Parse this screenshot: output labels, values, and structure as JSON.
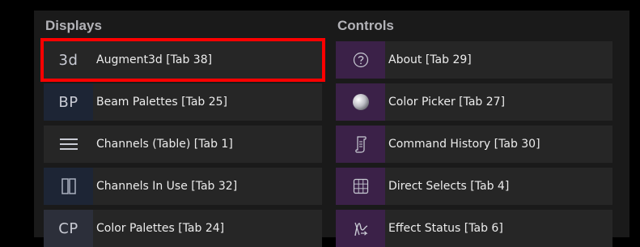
{
  "displays": {
    "title": "Displays",
    "items": [
      {
        "icon_text": "3d",
        "icon": "augment3d-icon",
        "label": "Augment3d [Tab 38]",
        "selected": true
      },
      {
        "icon_text": "BP",
        "icon": "beam-palettes-icon",
        "label": "Beam Palettes [Tab 25]"
      },
      {
        "icon_text": "",
        "icon": "hamburger-list-icon",
        "label": "Channels (Table) [Tab 1]"
      },
      {
        "icon_text": "",
        "icon": "split-columns-icon",
        "label": "Channels In Use [Tab 32]"
      },
      {
        "icon_text": "CP",
        "icon": "color-palettes-icon",
        "label": "Color Palettes [Tab 24]"
      }
    ]
  },
  "controls": {
    "title": "Controls",
    "items": [
      {
        "icon": "question-circle-icon",
        "label": "About [Tab 29]"
      },
      {
        "icon": "color-sphere-icon",
        "label": "Color Picker [Tab 27]"
      },
      {
        "icon": "scroll-icon",
        "label": "Command History [Tab 30]"
      },
      {
        "icon": "direct-select-grid-icon",
        "label": "Direct Selects [Tab 4]"
      },
      {
        "icon": "effect-wave-icon",
        "label": "Effect Status [Tab 6]"
      }
    ]
  },
  "colors": {
    "selection_outline": "#ff0000",
    "tile_bg": "#262626",
    "panel_bg": "#1a1a1a",
    "controls_icon_bg": "#3b2148"
  }
}
